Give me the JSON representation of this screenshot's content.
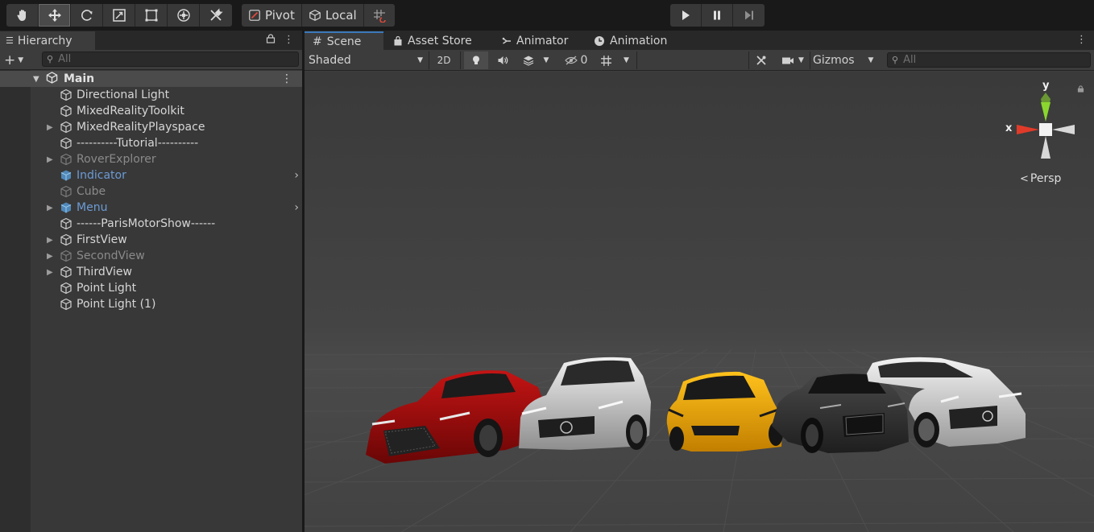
{
  "toolbar": {
    "tools": [
      "hand-tool",
      "move-tool",
      "rotate-tool",
      "scale-tool",
      "rect-tool",
      "transform-tool",
      "custom-tool"
    ],
    "active_tool": "move-tool",
    "pivot_label": "Pivot",
    "local_label": "Local"
  },
  "hierarchy": {
    "tab_label": "Hierarchy",
    "search_placeholder": "All",
    "scene_name": "Main",
    "items": [
      {
        "label": "Directional Light"
      },
      {
        "label": "MixedRealityToolkit"
      },
      {
        "label": "MixedRealityPlayspace"
      },
      {
        "label": "----------Tutorial----------"
      },
      {
        "label": "RoverExplorer"
      },
      {
        "label": "Indicator"
      },
      {
        "label": "Cube"
      },
      {
        "label": "Menu"
      },
      {
        "label": "------ParisMotorShow------"
      },
      {
        "label": "FirstView"
      },
      {
        "label": "SecondView"
      },
      {
        "label": "ThirdView"
      },
      {
        "label": "Point Light"
      },
      {
        "label": "Point Light (1)"
      }
    ]
  },
  "scene_tabs": {
    "scene": "Scene",
    "asset_store": "Asset Store",
    "animator": "Animator",
    "animation": "Animation"
  },
  "scene_toolbar": {
    "shading_mode": "Shaded",
    "mode_2d": "2D",
    "hidden_count": "0",
    "gizmos_label": "Gizmos",
    "search_placeholder": "All"
  },
  "gizmo": {
    "y_label": "y",
    "x_label": "x",
    "projection_label": "Persp"
  },
  "colors": {
    "selected_tab_accent": "#3a79bb",
    "prefab_text": "#6c9bd5",
    "axis_x": "#e03b2a",
    "axis_y": "#8ad62f"
  }
}
